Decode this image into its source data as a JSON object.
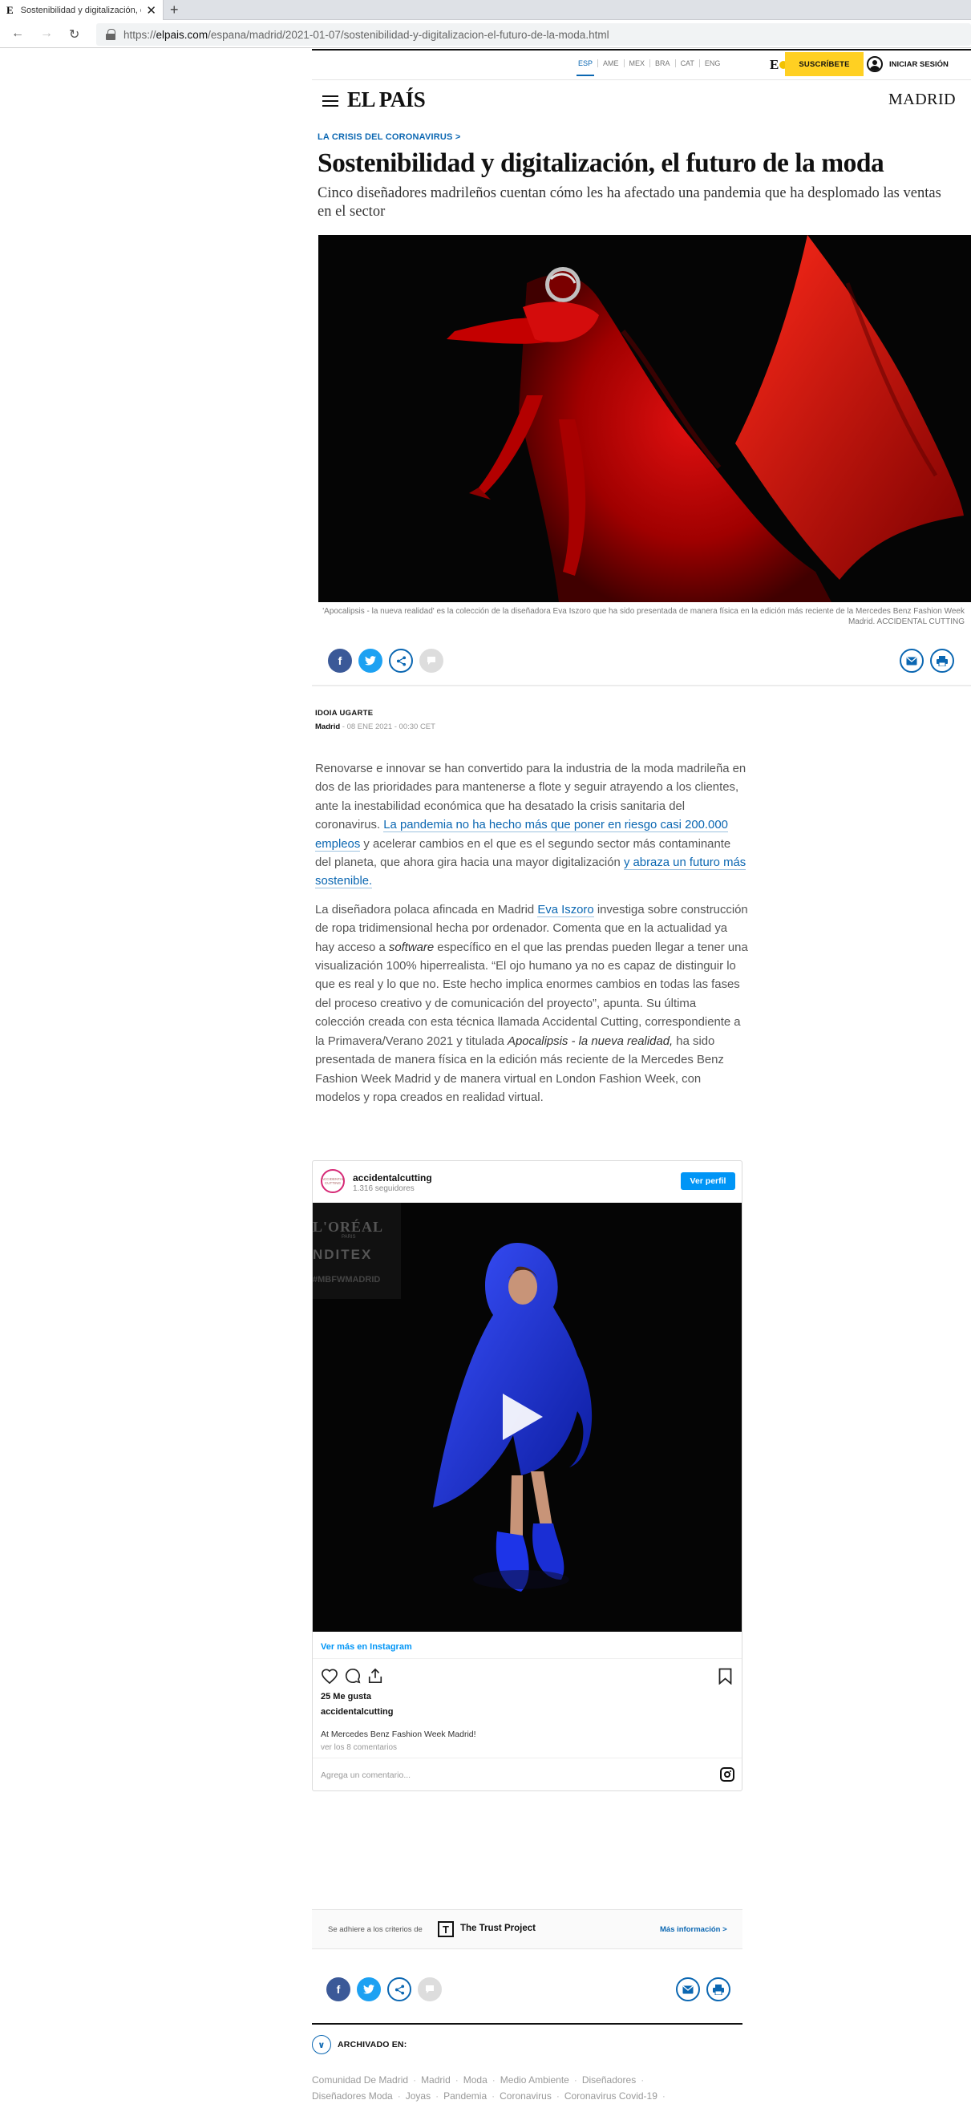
{
  "browser": {
    "tab_title": "Sostenibilidad y digitalización, el",
    "favicon": "E",
    "url_prefix": "https://",
    "url_host": "elpais.com",
    "url_path": "/espana/madrid/2021-01-07/sostenibilidad-y-digitalizacion-el-futuro-de-la-moda.html"
  },
  "header": {
    "editions": [
      "ESP",
      "AME",
      "MEX",
      "BRA",
      "CAT",
      "ENG"
    ],
    "subscribe_label": "SUSCRÍBETE",
    "login_label": "INICIAR SESIÓN",
    "logo": "EL PAÍS",
    "section": "MADRID",
    "ep_badge": "E"
  },
  "article": {
    "kicker": "LA CRISIS DEL CORONAVIRUS",
    "title": "Sostenibilidad y digitalización, el futuro de la moda",
    "deck": "Cinco diseñadores madrileños cuentan cómo les ha afectado una pandemia que ha desplomado las ventas en el sector",
    "caption": "'Apocalipsis - la nueva realidad' es la colección de la diseñadora Eva Iszoro que ha sido presentada de manera física en la edición más reciente de la Mercedes Benz Fashion Week Madrid. ACCIDENTAL CUTTING",
    "author": "IDOIA UGARTE",
    "location": "Madrid",
    "date": " - 08 ENE 2021 - 00:30 CET",
    "p1_a": "Renovarse e innovar se han convertido para la industria de la moda madrileña en dos de las prioridades para mantenerse a flote y seguir atrayendo a los clientes, ante la inestabilidad económica que ha desatado la crisis sanitaria del coronavirus. ",
    "p1_link1": "La pandemia no ha hecho más que poner en riesgo casi 200.000 empleos",
    "p1_b": " y acelerar cambios en el que es el segundo sector más contaminante del planeta, que ahora gira hacia una mayor digitalización ",
    "p1_link2": "y abraza un futuro más sostenible.",
    "p2_a": "La diseñadora polaca afincada en Madrid ",
    "p2_link": "Eva Iszoro",
    "p2_b": " investiga sobre construcción de ropa tridimensional hecha por ordenador. Comenta que en la actualidad ya hay acceso a ",
    "p2_em": "software",
    "p2_c": " específico en el que las prendas pueden llegar a tener una visualización 100% hiperrealista. “El ojo humano ya no es capaz de distinguir lo que es real y lo que no. Este hecho implica enormes cambios en todas las fases del proceso creativo y de comunicación del proyecto”, apunta. Su última colección creada con esta técnica llamada Accidental Cutting, correspondiente a la Primavera/Verano 2021 y titulada ",
    "p2_em2": "Apocalipsis - la nueva realidad,",
    "p2_d": " ha sido presentada de manera física en la edición más reciente de la Mercedes Benz Fashion Week Madrid y de manera virtual en London Fashion Week, con modelos y ropa creados en realidad virtual."
  },
  "instagram": {
    "avatar_text": "ACCIDENTAL CUTTING",
    "username": "accidentalcutting",
    "followers": "1.316 seguidores",
    "profile_button": "Ver perfil",
    "media_text_1": "L'ORÉAL",
    "media_text_1b": "PARIS",
    "media_text_2": "NDITEX",
    "media_text_3": "#MBFWMADRID",
    "see_more": "Ver más en Instagram",
    "likes": "25 Me gusta",
    "owner": "accidentalcutting",
    "caption": "At Mercedes Benz Fashion Week Madrid!",
    "comments": "ver los 8 comentarios",
    "add_comment": "Agrega un comentario..."
  },
  "trust": {
    "lead": "Se adhiere a los criterios de",
    "icon": "T",
    "name": "The Trust Project",
    "more": "Más información >"
  },
  "archive": {
    "label": "ARCHIVADO EN:",
    "tags_line1": [
      "Comunidad De Madrid",
      "Madrid",
      "Moda",
      "Medio Ambiente",
      "Diseñadores"
    ],
    "tags_line2": [
      "Diseñadores Moda",
      "Joyas",
      "Pandemia",
      "Coronavirus",
      "Coronavirus Covid-19"
    ]
  },
  "colors": {
    "accent": "#0b67b2",
    "subscribe": "#ffd022",
    "facebook": "#3b5998",
    "twitter": "#1da1f2",
    "instagram_blue": "#0095f6"
  },
  "icons": [
    "menu-icon",
    "facebook-icon",
    "twitter-icon",
    "share-icon",
    "comment-icon",
    "mail-icon",
    "print-icon",
    "user-icon",
    "lock-icon",
    "play-icon",
    "heart-icon",
    "bookmark-icon",
    "instagram-icon",
    "chevron-down-icon"
  ]
}
